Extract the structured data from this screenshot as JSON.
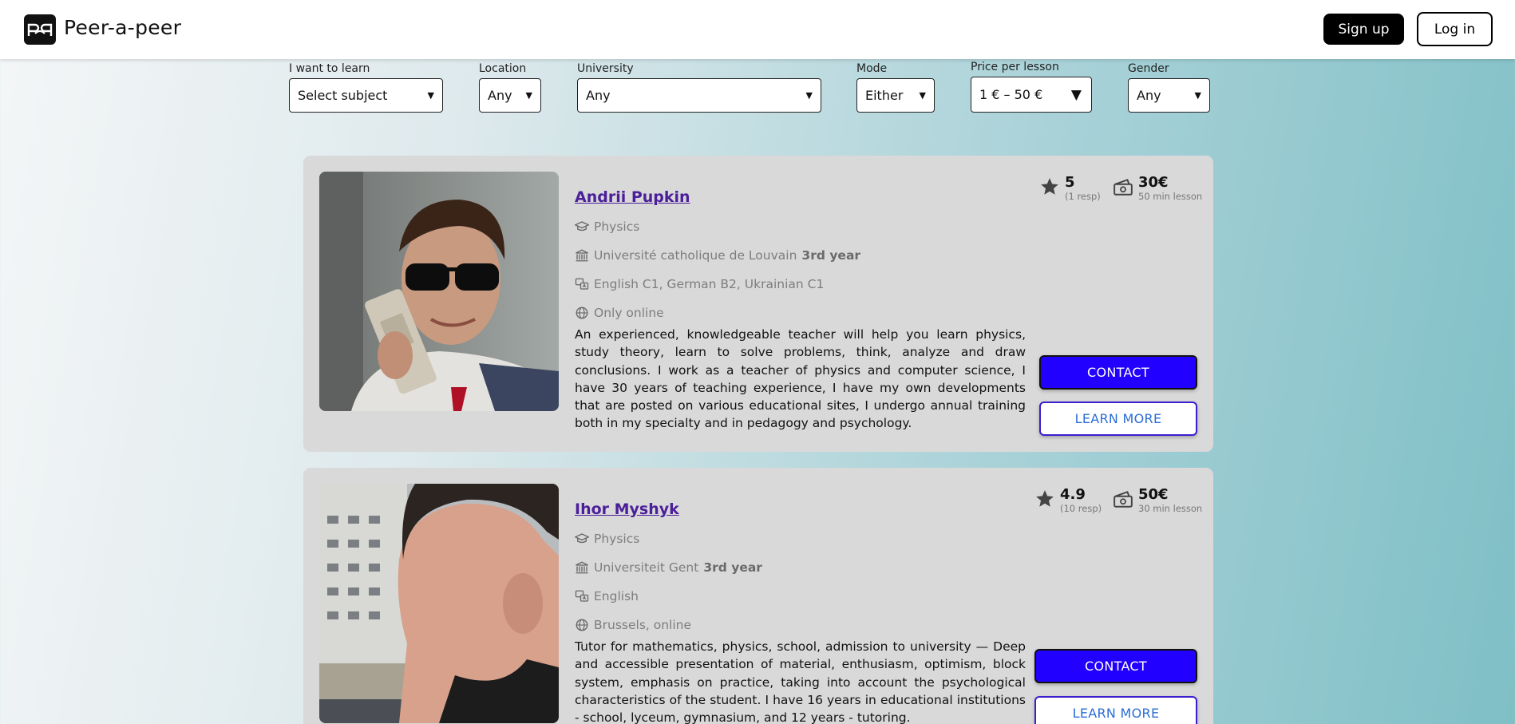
{
  "header": {
    "brand": "Peer-a-peer",
    "signup_label": "Sign up",
    "login_label": "Log in"
  },
  "filters": {
    "subject": {
      "label": "I want to learn",
      "value": "Select subject"
    },
    "location": {
      "label": "Location",
      "value": "Any"
    },
    "university": {
      "label": "University",
      "value": "Any"
    },
    "mode": {
      "label": "Mode",
      "value": "Either"
    },
    "price": {
      "label": "Price per lesson",
      "value": "1 € – 50 €"
    },
    "gender": {
      "label": "Gender",
      "value": "Any"
    }
  },
  "tutors": [
    {
      "name": "Andrii Pupkin",
      "subject": "Physics",
      "university": "Université catholique de Louvain",
      "year": "3rd year",
      "languages": "English C1, German B2, Ukrainian C1",
      "mode": "Only online",
      "description": "An experienced, knowledgeable teacher will help you learn physics, study theory, learn to solve problems, think, analyze and draw conclusions. I work as a teacher of physics and computer science, I have 30 years of teaching experience, I have my own developments that are posted on various educational sites, I undergo annual training both in my specialty and in pedagogy and psychology.",
      "rating": "5",
      "responses": "(1 resp)",
      "price": "30€",
      "lesson": "50 min lesson",
      "contact_label": "CONTACT",
      "learn_label": "LEARN MORE"
    },
    {
      "name": "Ihor Myshyk",
      "subject": "Physics",
      "university": "Universiteit Gent",
      "year": "3rd year",
      "languages": "English",
      "mode": "Brussels, online",
      "description": "Tutor for mathematics, physics, school, admission to university — Deep and accessible presentation of material, enthusiasm, optimism, block system, emphasis on practice, taking into account the psychological characteristics of the student. I have 16 years in educational institutions - school, lyceum, gymnasium, and 12 years - tutoring.",
      "rating": "4.9",
      "responses": "(10 resp)",
      "price": "50€",
      "lesson": "30 min lesson",
      "contact_label": "CONTACT",
      "learn_label": "LEARN MORE"
    }
  ],
  "colors": {
    "accent": "#2200ff",
    "name_link": "#4b1f9a",
    "card_bg": "#d9d9d9"
  }
}
